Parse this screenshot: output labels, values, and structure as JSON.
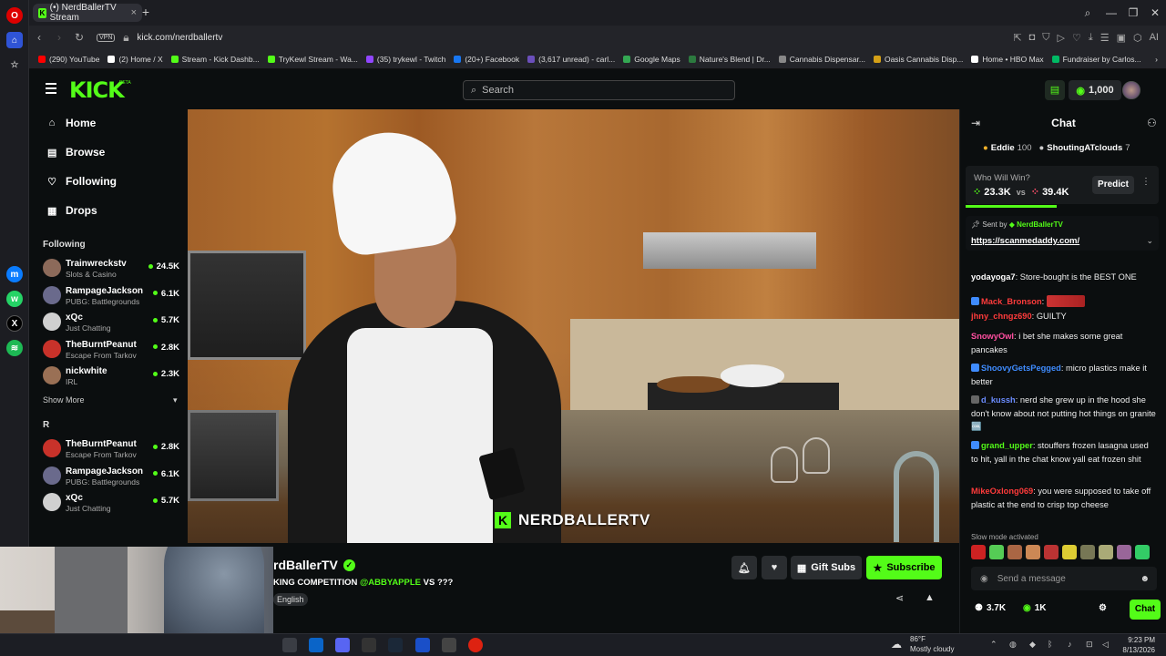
{
  "browser": {
    "tab_title": "(•) NerdBallerTV Stream",
    "tab_close": "×",
    "new_tab": "+",
    "url": "kick.com/nerdballertv",
    "vpn_label": "VPN",
    "ai_label": "AI",
    "bookmarks": [
      {
        "label": "(290) YouTube",
        "color": "#ff0000"
      },
      {
        "label": "(2) Home / X",
        "color": "#ffffff"
      },
      {
        "label": "Stream - Kick Dashb...",
        "color": "#53fc18"
      },
      {
        "label": "TryKewl Stream - Wa...",
        "color": "#53fc18"
      },
      {
        "label": "(35) trykewl - Twitch",
        "color": "#9146ff"
      },
      {
        "label": "(20+) Facebook",
        "color": "#1877f2"
      },
      {
        "label": "(3,617 unread) - carl...",
        "color": "#6b4fbb"
      },
      {
        "label": "Google Maps",
        "color": "#34a853"
      },
      {
        "label": "Nature's Blend | Dr...",
        "color": "#2c7a3f"
      },
      {
        "label": "Cannabis Dispensar...",
        "color": "#888888"
      },
      {
        "label": "Oasis Cannabis Disp...",
        "color": "#d4a017"
      },
      {
        "label": "Home • HBO Max",
        "color": "#ffffff"
      },
      {
        "label": "Fundraiser by Carlos...",
        "color": "#00b964"
      }
    ]
  },
  "header": {
    "logo": "KICK",
    "logo_badge": "BETA",
    "search_placeholder": "Search",
    "points": "1,000"
  },
  "nav": {
    "items": [
      {
        "label": "Home",
        "icon": "home-icon",
        "glyph": "⌂"
      },
      {
        "label": "Browse",
        "icon": "browse-icon",
        "glyph": "▤"
      },
      {
        "label": "Following",
        "icon": "heart-icon",
        "glyph": "♡"
      },
      {
        "label": "Drops",
        "icon": "drops-icon",
        "glyph": "▦"
      }
    ],
    "following_label": "Following",
    "following": [
      {
        "name": "Trainwreckstv",
        "category": "Slots & Casino",
        "viewers": "24.5K",
        "color": "#8c6a5a"
      },
      {
        "name": "RampageJackson",
        "category": "PUBG: Battlegrounds",
        "viewers": "6.1K",
        "color": "#6a6a8c"
      },
      {
        "name": "xQc",
        "category": "Just Chatting",
        "viewers": "5.7K",
        "color": "#d0d0d0"
      },
      {
        "name": "TheBurntPeanut",
        "category": "Escape From Tarkov",
        "viewers": "2.8K",
        "color": "#c8322a"
      },
      {
        "name": "nickwhite",
        "category": "IRL",
        "viewers": "2.3K",
        "color": "#9a7055"
      }
    ],
    "show_more": "Show More",
    "recommended_label": "R",
    "recommended": [
      {
        "name": "TheBurntPeanut",
        "category": "Escape From Tarkov",
        "viewers": "2.8K",
        "color": "#c8322a"
      },
      {
        "name": "RampageJackson",
        "category": "PUBG: Battlegrounds",
        "viewers": "6.1K",
        "color": "#6a6a8c"
      },
      {
        "name": "xQc",
        "category": "Just Chatting",
        "viewers": "5.7K",
        "color": "#d0d0d0"
      }
    ]
  },
  "video": {
    "watermark": "NERDBALLERTV"
  },
  "stream": {
    "channel_name": "rdBallerTV",
    "title_prefix": "KING COMPETITION",
    "title_mention": "@ABBYAPPLE",
    "title_suffix": "VS ???",
    "tag": "English",
    "gift_subs": "Gift Subs",
    "subscribe": "Subscribe"
  },
  "chat": {
    "title": "Chat",
    "top_gifters": [
      {
        "name": "Eddie",
        "count": "100"
      },
      {
        "name": "ShoutingATclouds",
        "count": "7"
      }
    ],
    "prediction": {
      "question": "Who Will Win?",
      "left": "23.3K",
      "vs": "vs",
      "right": "39.4K",
      "button": "Predict"
    },
    "pinned": {
      "sent_by": "Sent by",
      "user": "NerdBallerTV",
      "link": "https://scanmedaddy.com/"
    },
    "messages": [
      {
        "user": "yodayoga7",
        "color": "#ffffff",
        "text": "Store-bought is the BEST ONE"
      },
      {
        "user": "Mack_Bronson",
        "color": "#ff3b3b",
        "text": ""
      },
      {
        "user": "jhny_chngz690",
        "color": "#ff3b3b",
        "text": "GUILTY"
      },
      {
        "user": "SnowyOwl",
        "color": "#ff4fa0",
        "text": "i bet she makes some great pancakes"
      },
      {
        "user": "ShoovyGetsPegged",
        "color": "#3f8cff",
        "text": "micro plastics make it better"
      },
      {
        "user": "d_kussh",
        "color": "#6b8cff",
        "text": "nerd she grew up in the hood she don't know about not putting hot things on granite 🆒"
      },
      {
        "user": "grand_upper",
        "color": "#53fc18",
        "text": "stouffers frozen lasagna used to hit, yall in the chat know yall eat frozen shit"
      },
      {
        "user": "MikeOxlong069",
        "color": "#ff3b3b",
        "text": "you were supposed to take off plastic at the end to crisp top cheese"
      }
    ],
    "slow_mode": "Slow mode activated",
    "input_placeholder": "Send a message",
    "viewers": "3.7K",
    "points": "1K",
    "send": "Chat"
  },
  "taskbar": {
    "temp": "86°F",
    "weather": "Mostly cloudy",
    "time": "9:23 PM",
    "date": "8/13/2026"
  }
}
